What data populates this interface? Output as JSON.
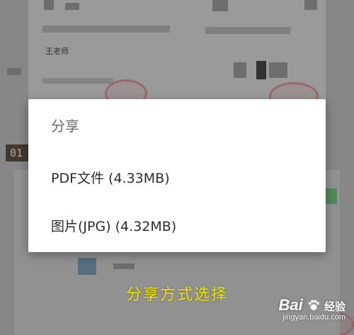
{
  "background": {
    "corner_text": "01",
    "handwriting": "王老师"
  },
  "dialog": {
    "title": "分享",
    "options": [
      {
        "label": "PDF文件 (4.33MB)"
      },
      {
        "label": "图片(JPG) (4.32MB)"
      }
    ]
  },
  "caption": "分享方式选择",
  "watermark": {
    "brand": "Bai",
    "brand_suffix": "经验",
    "url": "jingyan.baidu.com"
  },
  "colors": {
    "caption": "#f2e600",
    "dialog_bg": "#ffffff"
  }
}
